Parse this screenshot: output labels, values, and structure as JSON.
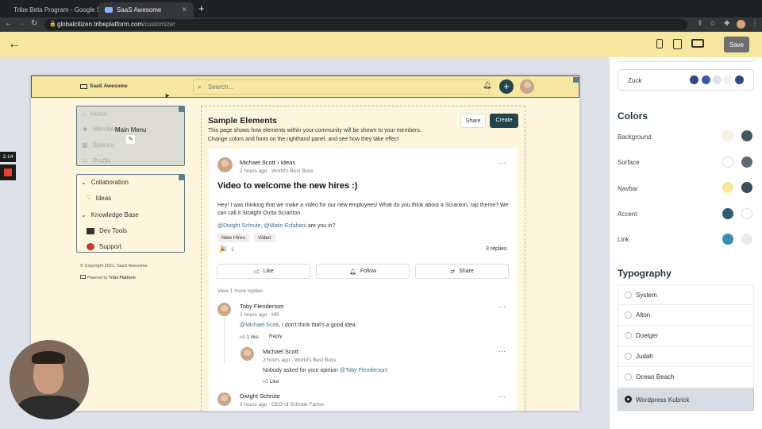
{
  "browser": {
    "tabs": [
      {
        "title": "Tribe Beta Program - Google S",
        "active": false
      },
      {
        "title": "SaaS Awesome",
        "active": true
      }
    ],
    "url_host": "globalcitizen.tribeplatform.com",
    "url_path": "/customizer"
  },
  "recording": {
    "timer": "2:14"
  },
  "customizer": {
    "save_label": "Save"
  },
  "preview": {
    "brand": "SaaS Awesome",
    "search_placeholder": "Search...",
    "main_menu": {
      "label": "Main Menu",
      "items": [
        "Home",
        "Members",
        "Spaces",
        "Profile"
      ]
    },
    "sidebar": {
      "groups": [
        {
          "title": "Collaboration",
          "items": [
            "Ideas"
          ]
        },
        {
          "title": "Knowledge Base",
          "items": [
            "Dev Tools",
            "Support"
          ]
        }
      ],
      "copyright": "© Copyright 2021, SaaS Awesome",
      "powered": "Powered by",
      "powered_brand": "Tribe Platform"
    },
    "sample": {
      "title": "Sample Elements",
      "desc1": "This page shows how elements within your community will be shown to your members.",
      "desc2": "Change colors and fonts on the righthand panel, and see how they take effect",
      "share_label": "Share",
      "create_label": "Create"
    },
    "post": {
      "author": "Michael Scott",
      "space": "Ideas",
      "meta": "2 hours ago · World's Best Boss",
      "title": "Video to welcome the new hires :)",
      "body": "Hey! I was thinking that we make a video for our new employees! What do you think about a Scranton, rap theme? We can call it Straight Outta Scranton.",
      "mention1": "@Dwight Schrute",
      "mention_sep": ", ",
      "mention2": "@Matin Esfahani",
      "mention_tail": " are you in?",
      "tags": [
        "New Hires",
        "Video"
      ],
      "reaction_count": "1",
      "replies": "3 replies",
      "actions": [
        "Like",
        "Follow",
        "Share"
      ],
      "view_more": "View 1 more replies"
    },
    "comments": [
      {
        "author": "Toby Flenderson",
        "meta": "2 hours ago · HR",
        "mention": "@Michael Scott",
        "text": ", I don't think that's a good idea.",
        "likes": "1 like",
        "reply": "Reply"
      },
      {
        "author": "Michael Scott",
        "meta": "2 hours ago · World's Best Boss",
        "prefix": "Nobody asked for your opinion ",
        "mention": "@Toby Flenderson!",
        "like": "Like"
      },
      {
        "author": "Dwight Schrute",
        "meta": "2 hours ago · CEO of Schrute Farms"
      }
    ]
  },
  "panel": {
    "theme_name": "Zuck",
    "theme_colors": [
      "#2e4a8a",
      "#3a5aa8",
      "#dde3ee",
      "#eef0f4",
      "#2e4a8a"
    ],
    "colors_heading": "Colors",
    "colors": [
      {
        "label": "Background",
        "a": "#f7f1e1",
        "b": "#44575f"
      },
      {
        "label": "Surface",
        "a": "#ffffff",
        "b": "#5c6c73"
      },
      {
        "label": "Navbar",
        "a": "#f6e7a1",
        "b": "#3d4e56"
      },
      {
        "label": "Accent",
        "a": "#2f5d6d",
        "b": "#ffffff"
      },
      {
        "label": "Link",
        "a": "#3a8fb0",
        "b": "#ebece3"
      }
    ],
    "typography_heading": "Typography",
    "fonts": [
      "System",
      "Alton",
      "Doelger",
      "Judah",
      "Ocean Beach",
      "Wordpress Kubrick"
    ],
    "selected_font": "Wordpress Kubrick"
  }
}
